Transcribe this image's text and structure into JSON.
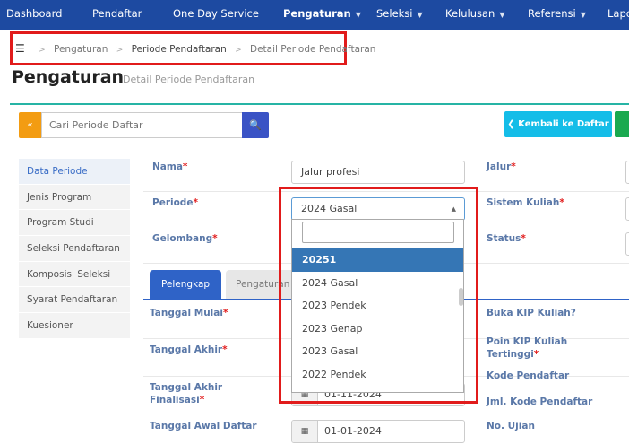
{
  "nav": {
    "items": [
      {
        "label": "Dashboard"
      },
      {
        "label": "Pendaftar"
      },
      {
        "label": "One Day Service"
      },
      {
        "label": "Pengaturan"
      },
      {
        "label": "Seleksi"
      },
      {
        "label": "Kelulusan"
      },
      {
        "label": "Referensi"
      },
      {
        "label": "Lapo"
      }
    ]
  },
  "breadcrumb": [
    "Pengaturan",
    "Periode Pendaftaran",
    "Detail Periode Pendaftaran"
  ],
  "page": {
    "title": "Pengaturan",
    "subtitle": "Detail Periode Pendaftaran"
  },
  "toolbar": {
    "toggle_label": "«",
    "search_placeholder": "Cari Periode Daftar",
    "back_label": "Kembali ke Daftar"
  },
  "sidebar": {
    "items": [
      {
        "label": "Data Periode"
      },
      {
        "label": "Jenis Program"
      },
      {
        "label": "Program Studi"
      },
      {
        "label": "Seleksi Pendaftaran"
      },
      {
        "label": "Komposisi Seleksi"
      },
      {
        "label": "Syarat Pendaftaran"
      },
      {
        "label": "Kuesioner"
      }
    ]
  },
  "form": {
    "nama_label": "Nama",
    "nama_value": "Jalur profesi",
    "periode_label": "Periode",
    "periode_value": "2024 Gasal",
    "gelombang_label": "Gelombang",
    "jalur_label": "Jalur",
    "sistem_kuliah_label": "Sistem Kuliah",
    "status_label": "Status",
    "required_mark": "*"
  },
  "tabs": {
    "pelengkap": "Pelengkap",
    "pengaturan": "Pengaturan"
  },
  "detail": {
    "tanggal_mulai_label": "Tanggal Mulai",
    "tanggal_akhir_label": "Tanggal Akhir",
    "tanggal_akhir_finalisasi_l1": "Tanggal Akhir",
    "tanggal_akhir_finalisasi_l2": "Finalisasi",
    "tanggal_akhir_finalisasi_value": "01-11-2024",
    "tanggal_awal_daftar_label": "Tanggal Awal Daftar",
    "tanggal_awal_daftar_value": "01-01-2024",
    "buka_kip_label": "Buka KIP Kuliah?",
    "poin_kip_l1": "Poin KIP Kuliah",
    "poin_kip_l2": "Tertinggi",
    "kode_pendaftar_label": "Kode Pendaftar",
    "jml_kode_label": "Jml. Kode Pendaftar",
    "no_ujian_label": "No. Ujian"
  },
  "dropdown": {
    "options": [
      "20251",
      "2024 Gasal",
      "2023 Pendek",
      "2023 Genap",
      "2023 Gasal",
      "2022 Pendek"
    ],
    "selected_index": 0
  },
  "colors": {
    "nav_bg": "#1d4aa1",
    "accent": "#2f63c7",
    "highlight": "#e11b1b"
  }
}
